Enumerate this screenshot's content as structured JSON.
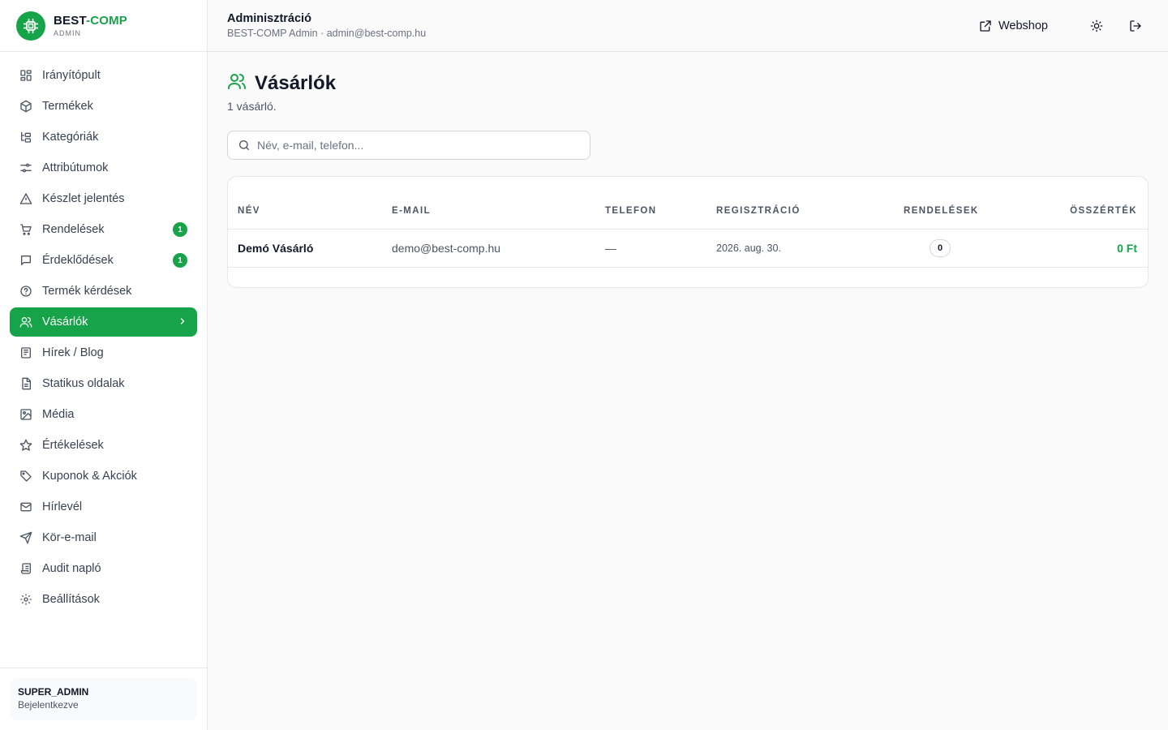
{
  "brand": {
    "name_a": "BEST",
    "name_sep": "-",
    "name_b": "COMP",
    "sub": "ADMIN"
  },
  "sidebar": {
    "items": [
      {
        "label": "Irányítópult",
        "icon": "dashboard-icon"
      },
      {
        "label": "Termékek",
        "icon": "package-icon"
      },
      {
        "label": "Kategóriák",
        "icon": "folder-tree-icon"
      },
      {
        "label": "Attribútumok",
        "icon": "sliders-icon"
      },
      {
        "label": "Készlet jelentés",
        "icon": "warning-icon"
      },
      {
        "label": "Rendelések",
        "icon": "cart-icon",
        "count": "1"
      },
      {
        "label": "Érdeklődések",
        "icon": "message-icon",
        "count": "1"
      },
      {
        "label": "Termék kérdések",
        "icon": "help-circle-icon"
      },
      {
        "label": "Vásárlók",
        "icon": "users-icon",
        "active": true
      },
      {
        "label": "Hírek / Blog",
        "icon": "newspaper-icon"
      },
      {
        "label": "Statikus oldalak",
        "icon": "file-text-icon"
      },
      {
        "label": "Média",
        "icon": "image-icon"
      },
      {
        "label": "Értékelések",
        "icon": "star-icon"
      },
      {
        "label": "Kuponok & Akciók",
        "icon": "tag-icon"
      },
      {
        "label": "Hírlevél",
        "icon": "mail-icon"
      },
      {
        "label": "Kör-e-mail",
        "icon": "send-icon"
      },
      {
        "label": "Audit napló",
        "icon": "scroll-icon"
      },
      {
        "label": "Beállítások",
        "icon": "gear-icon"
      }
    ],
    "user": {
      "role": "SUPER_ADMIN",
      "status": "Bejelentkezve"
    }
  },
  "header": {
    "title": "Adminisztráció",
    "subtitle": "BEST-COMP Admin · admin@best-comp.hu",
    "webshop_label": "Webshop"
  },
  "main": {
    "title": "Vásárlók",
    "count_text": "1 vásárló.",
    "search_placeholder": "Név, e-mail, telefon...",
    "columns": [
      "Név",
      "E-mail",
      "Telefon",
      "Regisztráció",
      "Rendelések",
      "Összérték"
    ],
    "rows": [
      {
        "name": "Demó Vásárló",
        "email": "demo@best-comp.hu",
        "phone": "—",
        "registered": "2026. aug. 30.",
        "orders": "0",
        "total": "0 Ft"
      }
    ]
  },
  "colors": {
    "accent": "#16a34a",
    "border": "#e5e7eb",
    "text": "#111827",
    "muted": "#6b7280"
  }
}
